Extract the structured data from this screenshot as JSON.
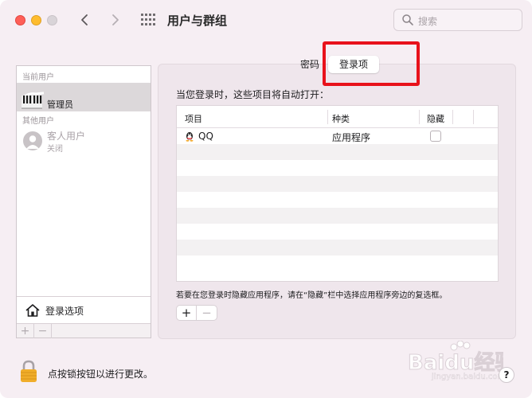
{
  "window": {
    "title": "用户与群组",
    "search_placeholder": "搜索"
  },
  "sidebar": {
    "current_users_label": "当前用户",
    "admin_name": "管理员",
    "other_users_label": "其他用户",
    "guest_name": "客人用户",
    "guest_status": "关闭",
    "login_options_label": "登录选项",
    "add_label": "+",
    "remove_label": "−"
  },
  "tabs": [
    {
      "label": "密码",
      "selected": false
    },
    {
      "label": "登录项",
      "selected": true
    }
  ],
  "login_items": {
    "description": "当您登录时，这些项目将自动打开：",
    "columns": [
      "项目",
      "种类",
      "隐藏"
    ],
    "rows": [
      {
        "item": "QQ",
        "kind": "应用程序",
        "hidden": false
      }
    ],
    "hint": "若要在您登录时隐藏应用程序，请在“隐藏”栏中选择应用程序旁边的复选框。",
    "add_label": "+",
    "remove_label": "−"
  },
  "footer": {
    "lock_text": "点按锁按钮以进行更改。",
    "help_label": "?"
  },
  "watermark": {
    "brand": "Baidu经验",
    "url": "jingyan.baidu.com"
  },
  "colors": {
    "window_bg": "#f6eef3",
    "highlight": "#e8121b",
    "close": "#fe5f57",
    "minimize": "#febc2e"
  },
  "icons": [
    "chevron-left-icon",
    "chevron-right-icon",
    "app-grid-icon",
    "search-icon",
    "house-icon",
    "qq-penguin-icon",
    "lock-icon",
    "help-icon"
  ]
}
